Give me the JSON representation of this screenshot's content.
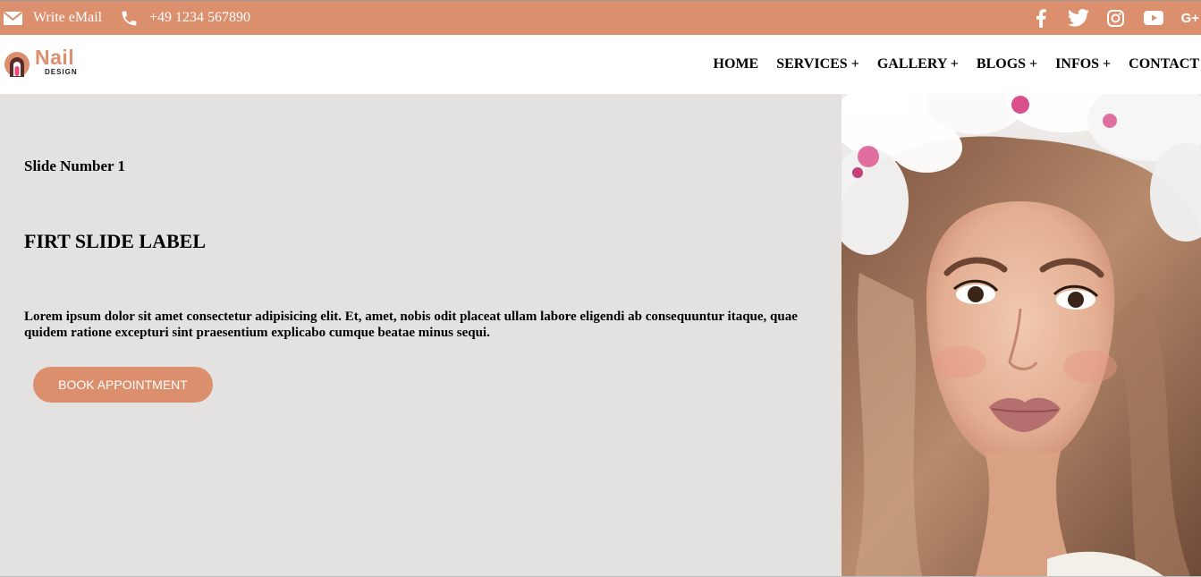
{
  "topbar": {
    "email_label": "Write eMail",
    "phone_label": "+49 1234 567890",
    "icons": {
      "email": "envelope-icon",
      "phone": "phone-icon"
    },
    "socials": [
      {
        "icon": "facebook-icon"
      },
      {
        "icon": "twitter-icon"
      },
      {
        "icon": "instagram-icon"
      },
      {
        "icon": "youtube-icon"
      },
      {
        "icon": "google-plus-icon",
        "text": "G+"
      }
    ],
    "colors": {
      "background": "#dc8f6d",
      "text": "#ffffff"
    }
  },
  "header": {
    "logo": {
      "word": "Nail",
      "sub": "DESIGN",
      "icon": "nail-logo-icon"
    },
    "nav": [
      "HOME",
      "SERVICES +",
      "GALLERY +",
      "BLOGS +",
      "INFOS +",
      "CONTACT"
    ]
  },
  "hero": {
    "slide_number": "Slide Number 1",
    "slide_label": "FIRT SLIDE LABEL",
    "slide_text": "Lorem ipsum dolor sit amet consectetur adipisicing elit. Et, amet, nobis odit placeat ullam labore eligendi ab consequuntur itaque, quae quidem ratione excepturi sint praesentium explicabo cumque beatae minus sequi.",
    "button_label": "BOOK APPOINTMENT",
    "colors": {
      "background": "#e4e2e1",
      "accent": "#dc8f6d"
    }
  },
  "photo": {
    "description_icon": "woman-portrait-image"
  }
}
